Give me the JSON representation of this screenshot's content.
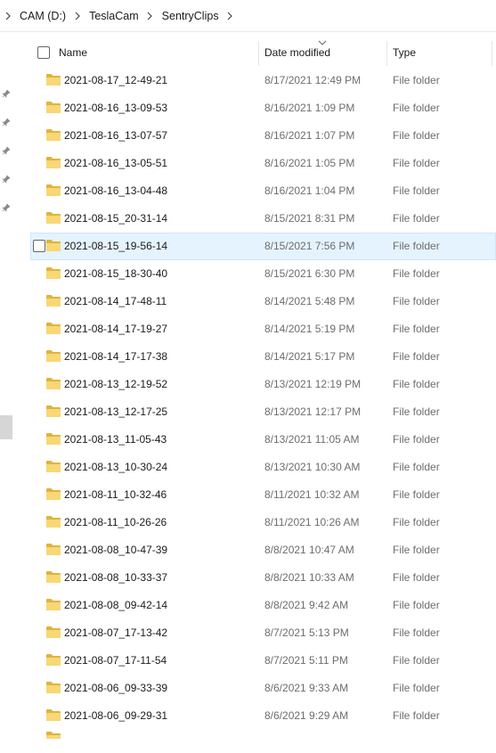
{
  "breadcrumb": {
    "items": [
      "CAM (D:)",
      "TeslaCam",
      "SentryClips"
    ]
  },
  "columns": {
    "name": "Name",
    "date_modified": "Date modified",
    "type": "Type"
  },
  "rows": [
    {
      "name": "2021-08-17_12-49-21",
      "date": "8/17/2021 12:49 PM",
      "type": "File folder"
    },
    {
      "name": "2021-08-16_13-09-53",
      "date": "8/16/2021 1:09 PM",
      "type": "File folder"
    },
    {
      "name": "2021-08-16_13-07-57",
      "date": "8/16/2021 1:07 PM",
      "type": "File folder"
    },
    {
      "name": "2021-08-16_13-05-51",
      "date": "8/16/2021 1:05 PM",
      "type": "File folder"
    },
    {
      "name": "2021-08-16_13-04-48",
      "date": "8/16/2021 1:04 PM",
      "type": "File folder"
    },
    {
      "name": "2021-08-15_20-31-14",
      "date": "8/15/2021 8:31 PM",
      "type": "File folder"
    },
    {
      "name": "2021-08-15_19-56-14",
      "date": "8/15/2021 7:56 PM",
      "type": "File folder",
      "hover": true
    },
    {
      "name": "2021-08-15_18-30-40",
      "date": "8/15/2021 6:30 PM",
      "type": "File folder"
    },
    {
      "name": "2021-08-14_17-48-11",
      "date": "8/14/2021 5:48 PM",
      "type": "File folder"
    },
    {
      "name": "2021-08-14_17-19-27",
      "date": "8/14/2021 5:19 PM",
      "type": "File folder"
    },
    {
      "name": "2021-08-14_17-17-38",
      "date": "8/14/2021 5:17 PM",
      "type": "File folder"
    },
    {
      "name": "2021-08-13_12-19-52",
      "date": "8/13/2021 12:19 PM",
      "type": "File folder"
    },
    {
      "name": "2021-08-13_12-17-25",
      "date": "8/13/2021 12:17 PM",
      "type": "File folder"
    },
    {
      "name": "2021-08-13_11-05-43",
      "date": "8/13/2021 11:05 AM",
      "type": "File folder"
    },
    {
      "name": "2021-08-13_10-30-24",
      "date": "8/13/2021 10:30 AM",
      "type": "File folder"
    },
    {
      "name": "2021-08-11_10-32-46",
      "date": "8/11/2021 10:32 AM",
      "type": "File folder"
    },
    {
      "name": "2021-08-11_10-26-26",
      "date": "8/11/2021 10:26 AM",
      "type": "File folder"
    },
    {
      "name": "2021-08-08_10-47-39",
      "date": "8/8/2021 10:47 AM",
      "type": "File folder"
    },
    {
      "name": "2021-08-08_10-33-37",
      "date": "8/8/2021 10:33 AM",
      "type": "File folder"
    },
    {
      "name": "2021-08-08_09-42-14",
      "date": "8/8/2021 9:42 AM",
      "type": "File folder"
    },
    {
      "name": "2021-08-07_17-13-42",
      "date": "8/7/2021 5:13 PM",
      "type": "File folder"
    },
    {
      "name": "2021-08-07_17-11-54",
      "date": "8/7/2021 5:11 PM",
      "type": "File folder"
    },
    {
      "name": "2021-08-06_09-33-39",
      "date": "8/6/2021 9:33 AM",
      "type": "File folder"
    },
    {
      "name": "2021-08-06_09-29-31",
      "date": "8/6/2021 9:29 AM",
      "type": "File folder"
    }
  ],
  "icons": {
    "folder": "folder-icon",
    "pin": "pin-icon",
    "chevron": "chevron-right-icon",
    "sort": "sort-descending-icon"
  },
  "colors": {
    "folder": "#f8d775",
    "folder_dark": "#e0b33f",
    "hover": "#e5f3ff"
  }
}
